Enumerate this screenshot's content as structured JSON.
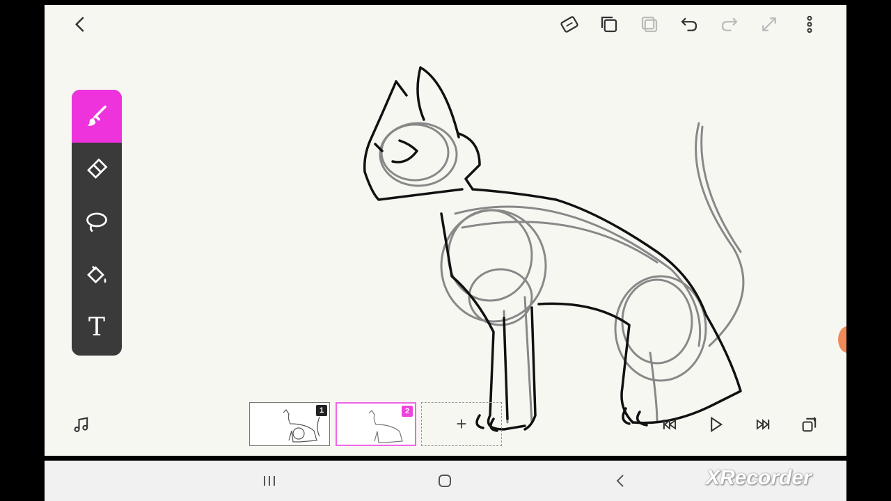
{
  "top_bar": {
    "icons": [
      "back-arrow-icon",
      "onion-skin-icon",
      "copy-frame-icon",
      "paste-frame-icon",
      "undo-icon",
      "redo-icon",
      "fullscreen-icon",
      "more-vert-icon"
    ]
  },
  "tools": [
    {
      "name": "brush-icon",
      "active": true
    },
    {
      "name": "eraser-icon",
      "active": false
    },
    {
      "name": "lasso-icon",
      "active": false
    },
    {
      "name": "fill-bucket-icon",
      "active": false
    },
    {
      "name": "text-tool",
      "label": "T",
      "active": false
    }
  ],
  "timeline": {
    "frames": [
      {
        "number": "1",
        "selected": false,
        "badge_color": "#222222"
      },
      {
        "number": "2",
        "selected": true,
        "badge_color": "#ee44dd"
      }
    ],
    "add_label": "+"
  },
  "playback": {
    "icons": [
      "music-icon",
      "skip-start-icon",
      "play-icon",
      "skip-end-icon",
      "frames-settings-icon"
    ]
  },
  "colors": {
    "accent": "#ee33dd",
    "toolbar_bg": "#3a3a3a",
    "canvas_bg": "#f7f7f2"
  },
  "system_nav": {
    "icons": [
      "recents-icon",
      "home-icon",
      "back-icon"
    ]
  },
  "watermark": "XRecorder"
}
